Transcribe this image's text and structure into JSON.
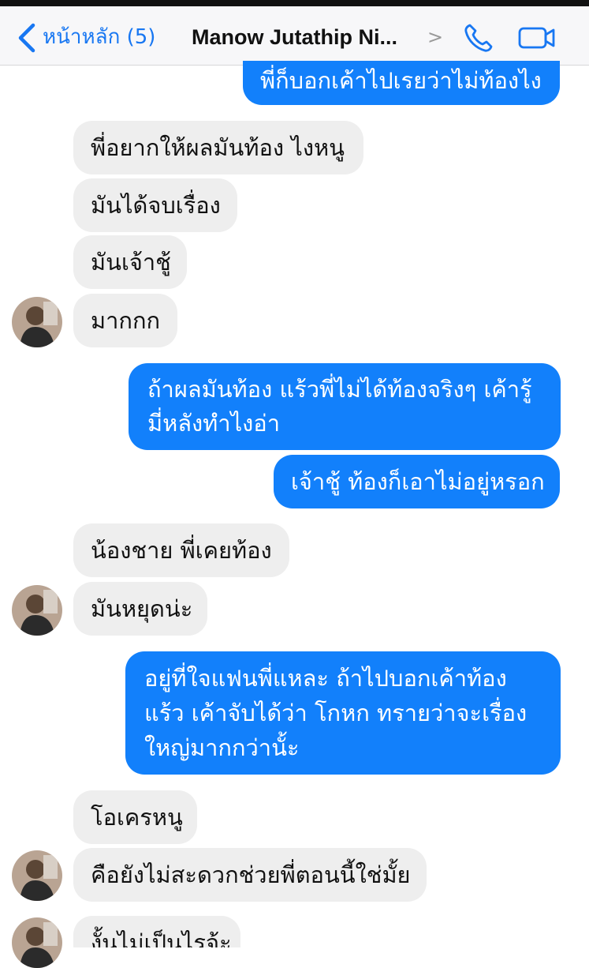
{
  "nav": {
    "back_label": "หน้าหลัก (5)",
    "title": "Manow Jutathip Ni...",
    "title_arrow": ">"
  },
  "messages": [
    {
      "dir": "out",
      "text": "พี่ก็บอกเค้าไปเรยว่าไม่ท้องไง"
    },
    {
      "dir": "in",
      "text": "พี่อยากให้ผลมันท้อง ไงหนู"
    },
    {
      "dir": "in",
      "text": "มันได้จบเรื่อง"
    },
    {
      "dir": "in",
      "text": "มันเจ้าชู้"
    },
    {
      "dir": "in",
      "text": "มากกก"
    },
    {
      "dir": "out",
      "text": "ถ้าผลมันท้อง แร้วพี่ไม่ได้ท้องจริงๆ เค้ารู้มี่หลังทำไงอ่า"
    },
    {
      "dir": "out",
      "text": "เจ้าชู้ ท้องก็เอาไม่อยู่หรอก"
    },
    {
      "dir": "in",
      "text": "น้องชาย พี่เคยท้อง"
    },
    {
      "dir": "in",
      "text": "มันหยุดน่ะ"
    },
    {
      "dir": "out",
      "text": "อยู่ที่ใจแฟนพี่แหละ ถ้าไปบอกเค้าท้องแร้ว เค้าจับได้ว่า โกหก ทรายว่าจะเรื่อง ใหญ่มากกว่านั้ะ"
    },
    {
      "dir": "in",
      "text": "โอเครหนู"
    },
    {
      "dir": "in",
      "text": "คือยังไม่สะดวกช่วยพี่ตอนนี้ใช่มั้ย"
    },
    {
      "dir": "in",
      "text": "งั้นไม่เป็นไรจ้ะ"
    }
  ]
}
